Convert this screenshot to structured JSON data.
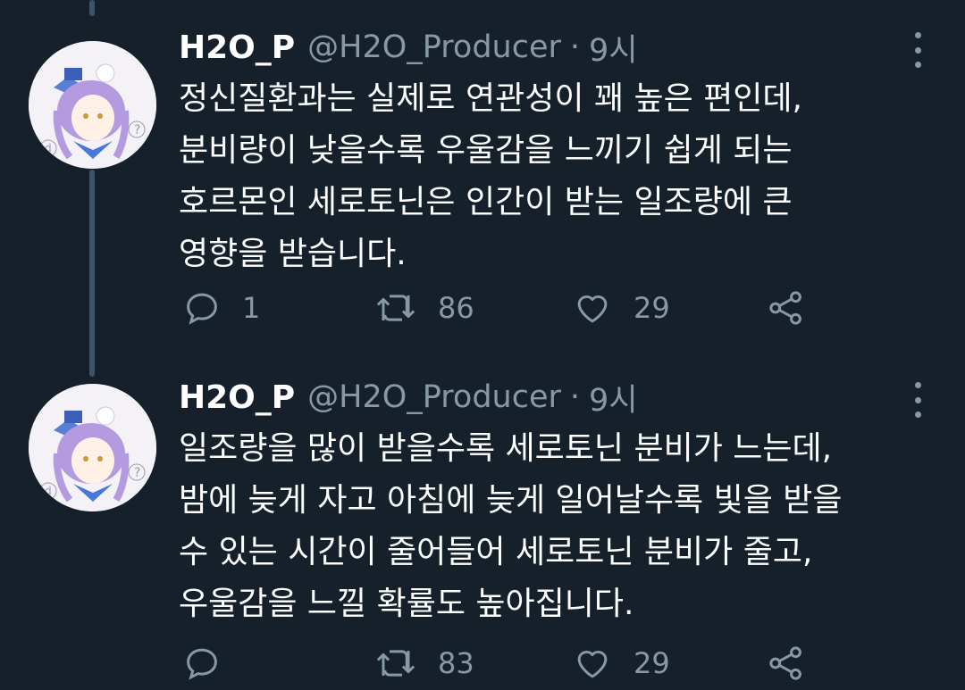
{
  "tweets": [
    {
      "display_name": "H2O_P",
      "handle": "@H2O_Producer",
      "separator": "·",
      "time": "9시",
      "lines": [
        "정신질환과는 실제로 연관성이 꽤 높은 편인데,",
        "분비량이 낮을수록 우울감을 느끼기 쉽게 되는",
        "호르몬인 세로토닌은 인간이 받는 일조량에 큰",
        "영향을 받습니다."
      ],
      "replies": "1",
      "retweets": "86",
      "likes": "29"
    },
    {
      "display_name": "H2O_P",
      "handle": "@H2O_Producer",
      "separator": "·",
      "time": "9시",
      "lines": [
        "일조량을 많이 받을수록 세로토닌 분비가 느는데,",
        "밤에 늦게 자고 아침에 늦게 일어날수록 빛을 받을",
        "수 있는 시간이 줄어들어 세로토닌 분비가 줄고,",
        "우울감을 느낄 확률도 높아집니다."
      ],
      "replies": "",
      "retweets": "83",
      "likes": "29"
    }
  ],
  "icons": {
    "reply": "reply-icon",
    "retweet": "retweet-icon",
    "like": "heart-icon",
    "share": "share-icon",
    "more": "more-vertical-icon"
  },
  "colors": {
    "background": "#15202b",
    "secondary_text": "#8899a6",
    "thread_line": "#3d5466"
  }
}
